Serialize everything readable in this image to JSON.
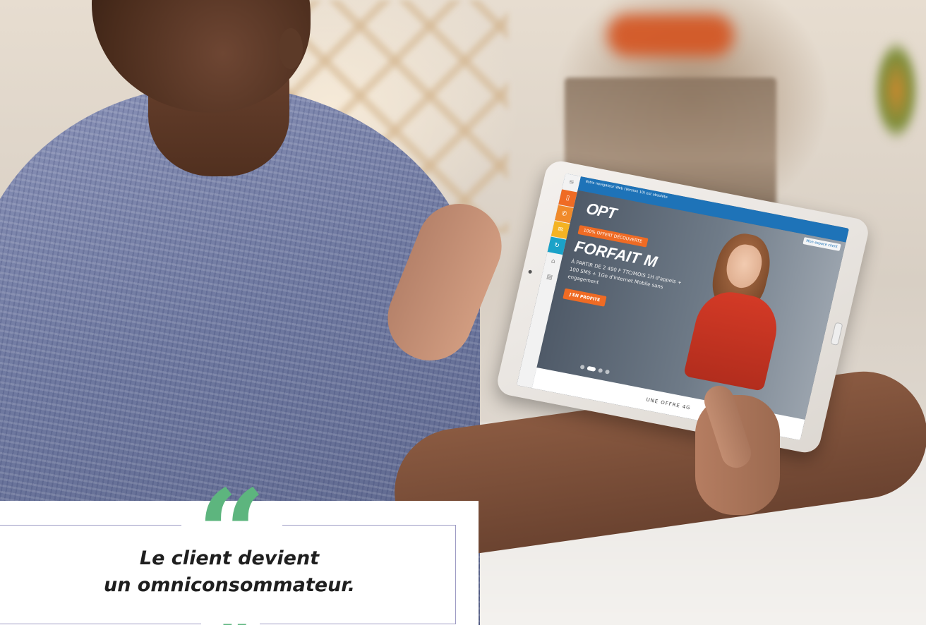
{
  "photo": {
    "description_icon": "person-using-tablet-photo"
  },
  "tablet": {
    "topbar_text": "Votre navigateur Web (Version 10) est obsolète",
    "user_button": "Mon espace client",
    "logo": "OPT",
    "badge": "100% OFFERT DÉCOUVERTE",
    "title": "FORFAIT M",
    "text": "À PARTIR DE 2 490 F TTC/MOIS 1H d'appels + 100 SMS + 1Go d'Internet Mobile sans engagement",
    "cta": "J'EN PROFITE",
    "bottom_text": "UNE OFFRE 4G"
  },
  "quote": {
    "open_mark": "“",
    "close_mark": "”",
    "line1": "Le client devient",
    "line2": "un omniconsommateur.",
    "accent_color": "#5db57e",
    "border_color": "#9d9bc4"
  }
}
